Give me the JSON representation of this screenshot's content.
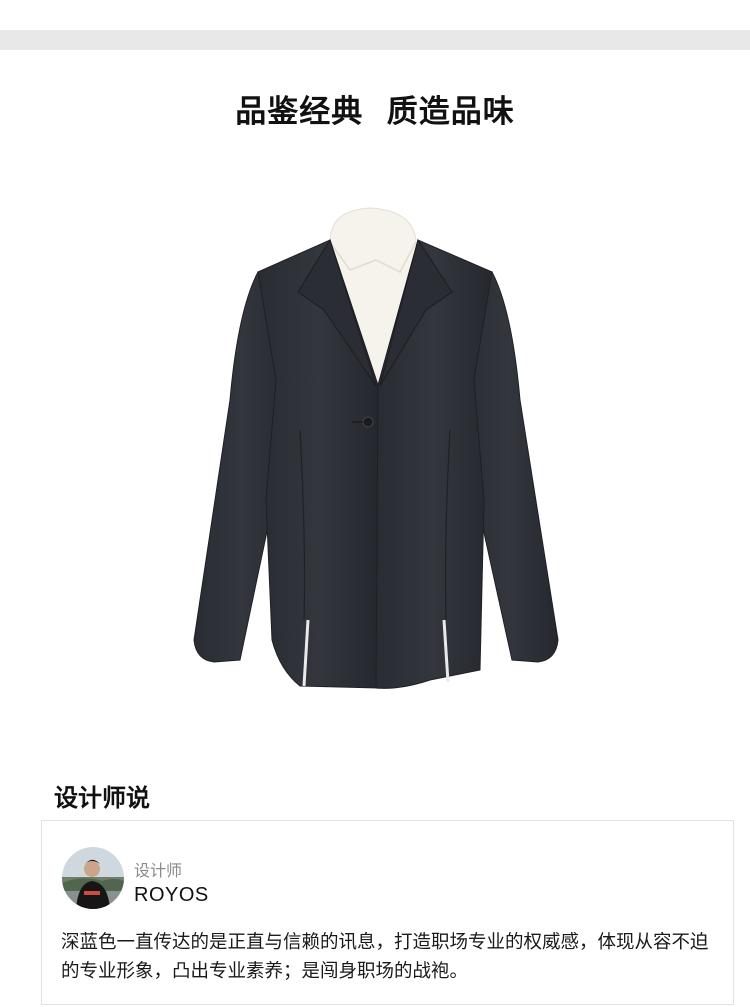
{
  "hero": {
    "title": "品鉴经典  质造品味"
  },
  "product": {
    "image_icon": "navy-blazer-image",
    "jacket_color": "#2e3038",
    "shirt_color": "#f6f3ec"
  },
  "designer_section": {
    "title": "设计师说",
    "role": "设计师",
    "name": "ROYOS",
    "avatar_icon": "designer-avatar",
    "quote": "深蓝色一直传达的是正直与信赖的讯息，打造职场专业的权威感，体现从容不迫的专业形象，凸出专业素养；是闯身职场的战袍。"
  },
  "colors": {
    "top_bar": "#e8e8e8",
    "card_border": "#e2e2e2",
    "muted_text": "#8a8a8a"
  }
}
